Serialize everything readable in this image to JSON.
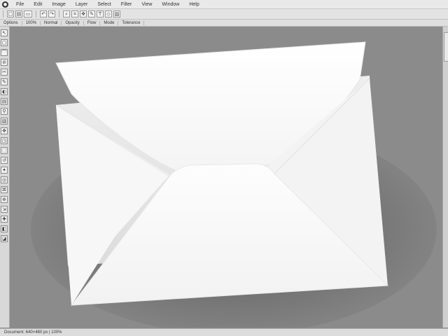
{
  "app": {
    "icon": "app-logo-icon",
    "icon_glyph": "●"
  },
  "menubar": {
    "items": [
      "File",
      "Edit",
      "Image",
      "Layer",
      "Select",
      "Filter",
      "View",
      "Window",
      "Help"
    ]
  },
  "toolbar": {
    "buttons": [
      {
        "name": "new-icon",
        "glyph": "□"
      },
      {
        "name": "open-icon",
        "glyph": "▤"
      },
      {
        "name": "save-icon",
        "glyph": "▭"
      },
      {
        "name": "undo-icon",
        "glyph": "↶"
      },
      {
        "name": "redo-icon",
        "glyph": "↷"
      },
      {
        "name": "zoom-icon",
        "glyph": "⌕"
      },
      {
        "name": "crop-icon",
        "glyph": "⌗"
      },
      {
        "name": "move-icon",
        "glyph": "✥"
      },
      {
        "name": "brush-icon",
        "glyph": "✎"
      },
      {
        "name": "text-icon",
        "glyph": "T"
      },
      {
        "name": "shape-icon",
        "glyph": "◇"
      },
      {
        "name": "fill-icon",
        "glyph": "▨"
      }
    ]
  },
  "optionsbar": {
    "items": [
      "Options",
      "100%",
      "Normal",
      "Opacity",
      "Flow",
      "Mode",
      "Tolerance"
    ]
  },
  "tools": [
    "↖",
    "▢",
    "⌒",
    "⊘",
    "✂",
    "✎",
    "◐",
    "▤",
    "⚲",
    "▧",
    "✥",
    "◳",
    "⬚",
    "↺",
    "✦",
    "◎",
    "⌘",
    "⊕",
    "⇲",
    "✚",
    "◧",
    "◪"
  ],
  "statusbar": {
    "text": "Document: 640×480 px | 100%"
  },
  "canvas": {
    "background": "#8b8b8b",
    "envelope_color": "#fafafa"
  }
}
